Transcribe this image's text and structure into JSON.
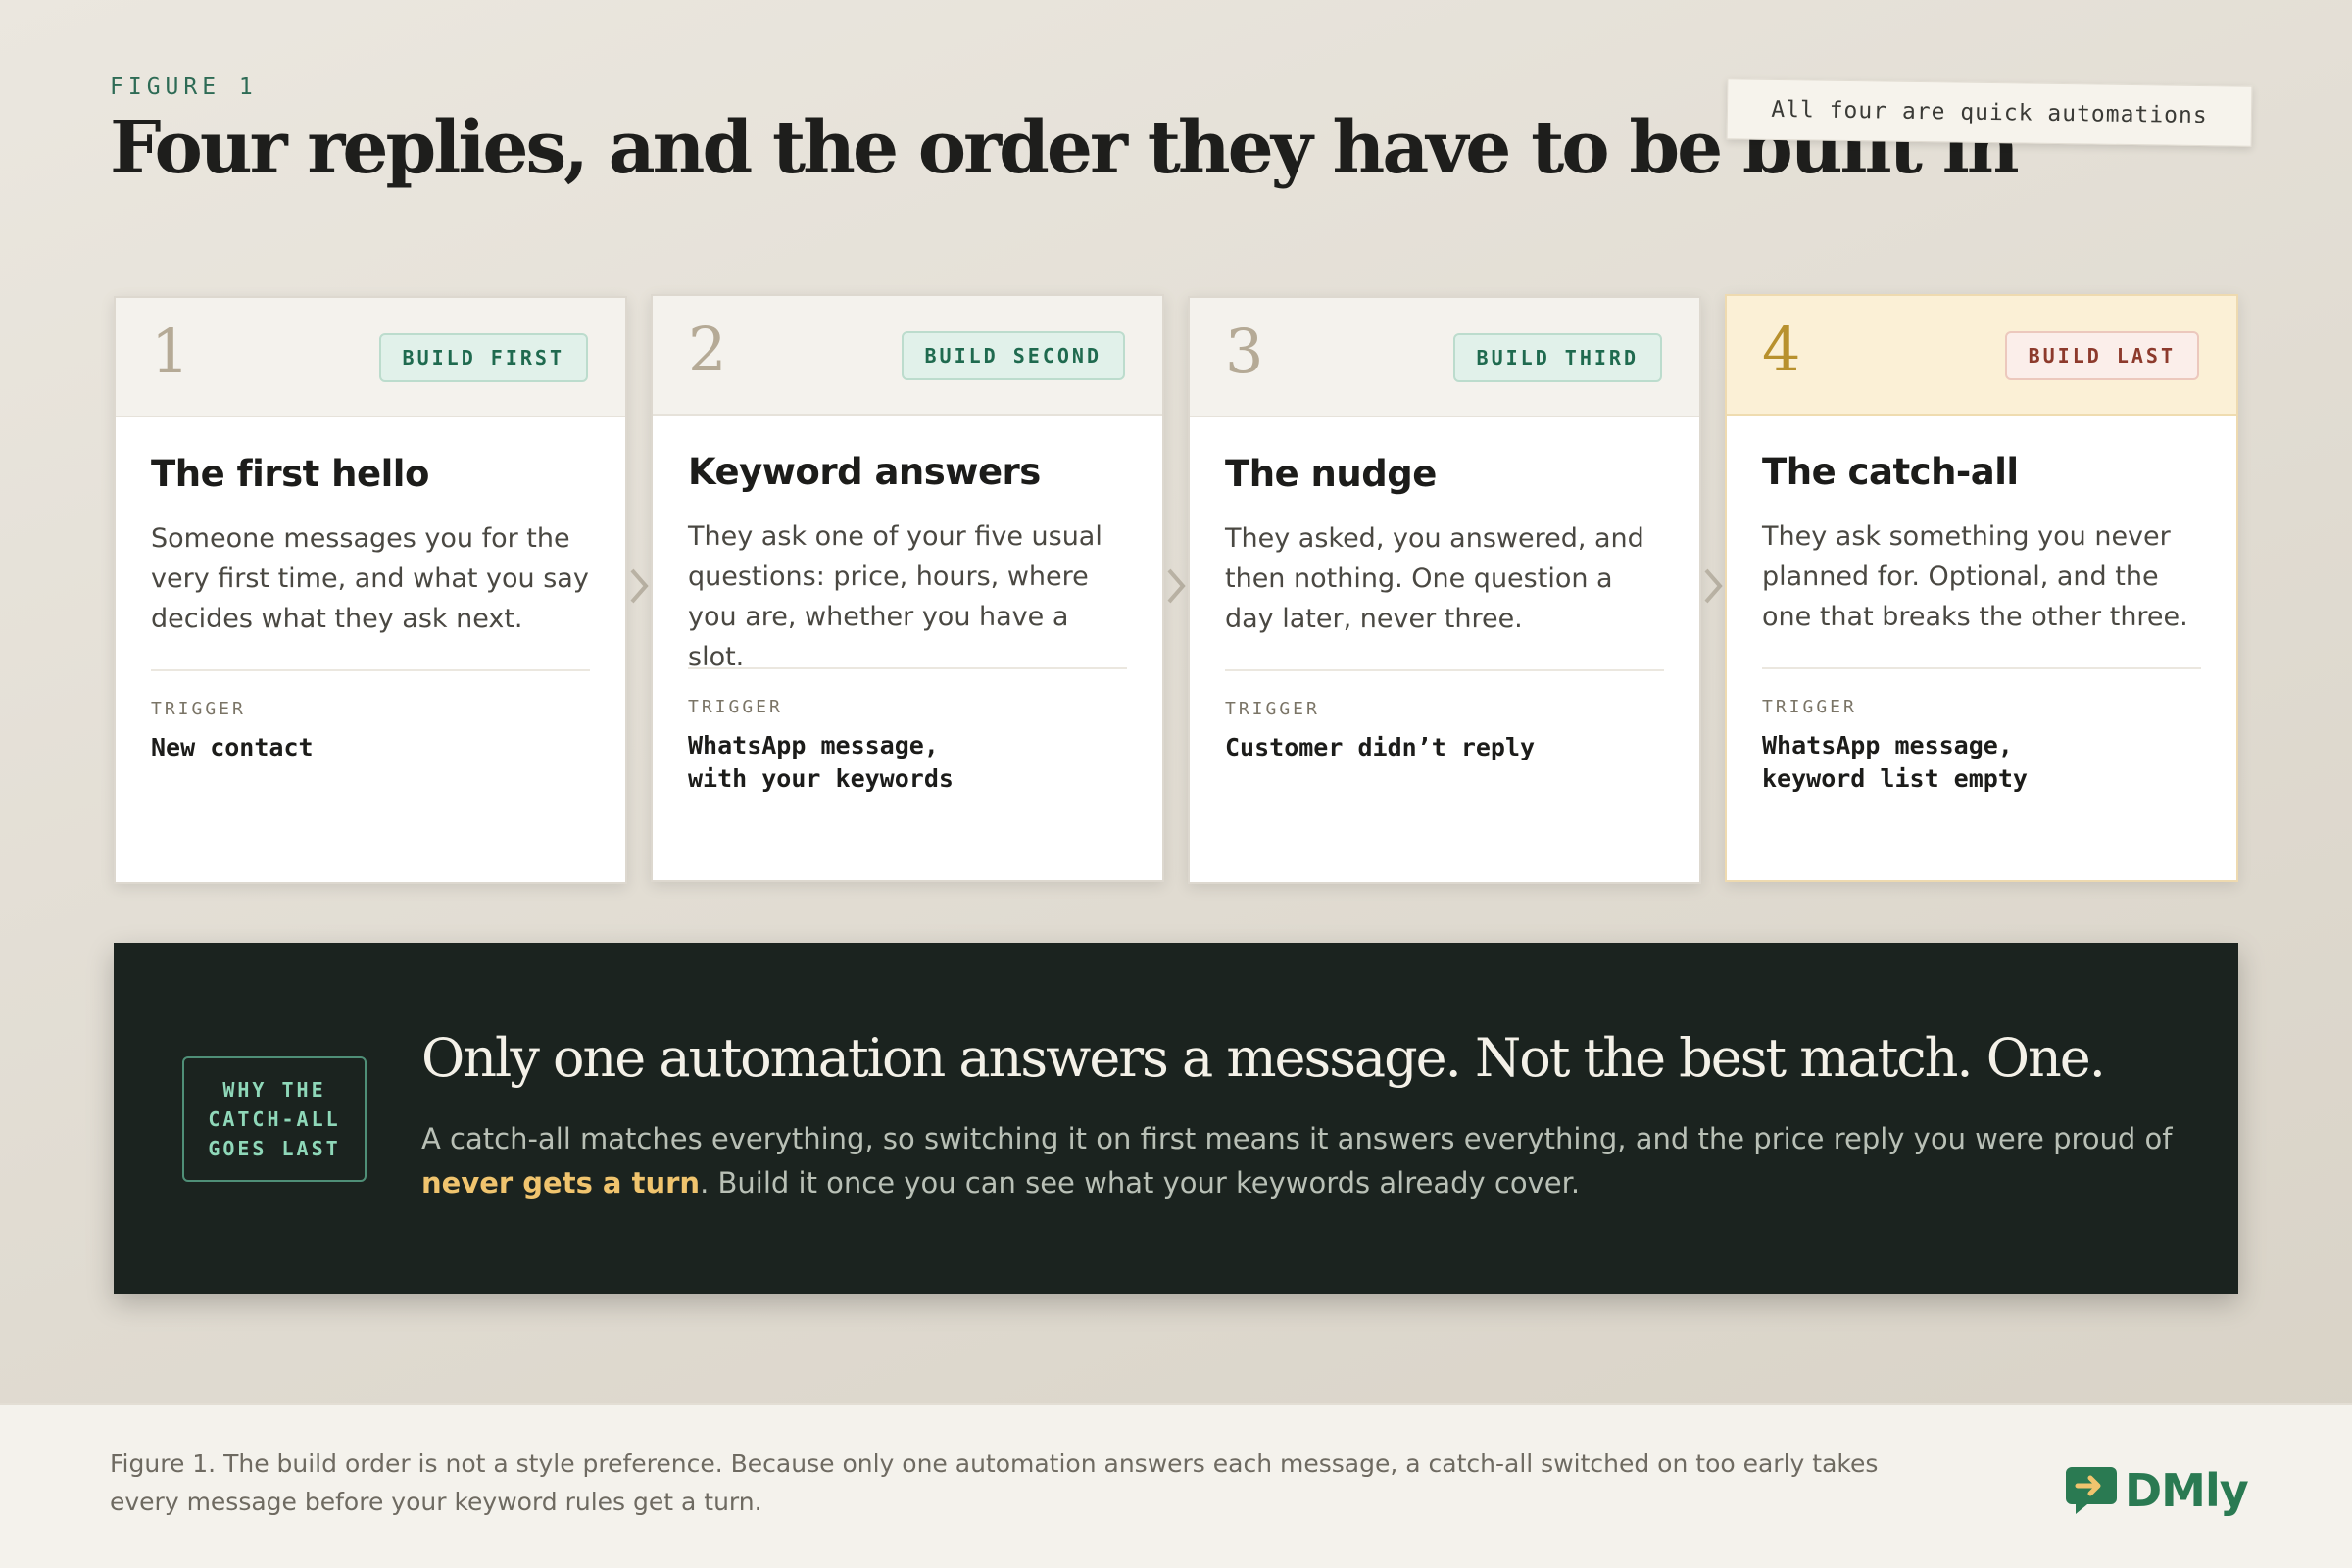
{
  "header": {
    "eyebrow": "FIGURE 1",
    "title": "Four replies, and the order they have to be built in",
    "note": "All four are quick automations"
  },
  "cards": [
    {
      "number": "1",
      "badge": "BUILD FIRST",
      "title": "The first hello",
      "description": "Someone messages you for the very first time, and what you say decides what they ask next.",
      "trigger_label": "TRIGGER",
      "trigger": "New contact"
    },
    {
      "number": "2",
      "badge": "BUILD SECOND",
      "title": "Keyword answers",
      "description": "They ask one of your five usual questions: price, hours, where you are, whether you have a slot.",
      "trigger_label": "TRIGGER",
      "trigger": "WhatsApp message,\nwith your keywords"
    },
    {
      "number": "3",
      "badge": "BUILD THIRD",
      "title": "The nudge",
      "description": "They asked, you answered, and then nothing. One question a day later, never three.",
      "trigger_label": "TRIGGER",
      "trigger": "Customer didn’t reply"
    },
    {
      "number": "4",
      "badge": "BUILD LAST",
      "title": "The catch-all",
      "description": "They ask something you never planned for. Optional, and the one that breaks the other three.",
      "trigger_label": "TRIGGER",
      "trigger": "WhatsApp message,\nkeyword list empty"
    }
  ],
  "callout": {
    "tag": "WHY THE\nCATCH-ALL\nGOES LAST",
    "heading": "Only one automation answers a message. Not the best match. One.",
    "text_before": "A catch-all matches everything, so switching it on first means it answers everything, and the price reply you were proud of ",
    "highlight": "never gets a turn",
    "text_after": ". Build it once you can see what your keywords already cover."
  },
  "footer": {
    "caption": "Figure 1. The build order is not a style preference. Because only one automation answers each message, a catch-all switched on too early takes every message before your keyword rules get a turn.",
    "logo_text": "DMly"
  },
  "colors": {
    "accent_green": "#2e6b55",
    "callout_bg": "#1b231f",
    "highlight": "#f0c46e",
    "last_card_tint": "#fbf0d6"
  },
  "icons": [
    "chevron-right-icon",
    "chat-arrow-logo-icon"
  ]
}
